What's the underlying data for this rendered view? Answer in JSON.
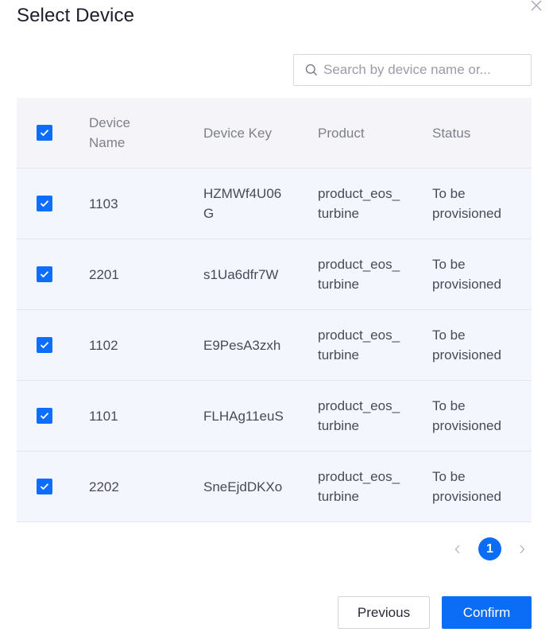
{
  "dialog": {
    "title": "Select Device",
    "close_icon": "close-icon"
  },
  "search": {
    "placeholder": "Search by device name or...",
    "value": "",
    "icon": "search-icon"
  },
  "table": {
    "select_all_checked": true,
    "columns": [
      "Device Name",
      "Device Key",
      "Product",
      "Status"
    ],
    "rows": [
      {
        "checked": true,
        "name": "1103",
        "key": "HZMWf4U06G",
        "product": "product_eos_turbine",
        "status": "To be provisioned"
      },
      {
        "checked": true,
        "name": "2201",
        "key": "s1Ua6dfr7W",
        "product": "product_eos_turbine",
        "status": "To be provisioned"
      },
      {
        "checked": true,
        "name": "1102",
        "key": "E9PesA3zxh",
        "product": "product_eos_turbine",
        "status": "To be provisioned"
      },
      {
        "checked": true,
        "name": "1101",
        "key": "FLHAg11euS",
        "product": "product_eos_turbine",
        "status": "To be provisioned"
      },
      {
        "checked": true,
        "name": "2202",
        "key": "SneEjdDKXo",
        "product": "product_eos_turbine",
        "status": "To be provisioned"
      }
    ]
  },
  "pagination": {
    "current_page": "1",
    "prev_icon": "chevron-left-icon",
    "next_icon": "chevron-right-icon"
  },
  "footer": {
    "previous_label": "Previous",
    "confirm_label": "Confirm"
  },
  "colors": {
    "primary": "#0b6cf5",
    "row_bg": "#f3f6fd",
    "header_bg": "#f5f5f9"
  }
}
